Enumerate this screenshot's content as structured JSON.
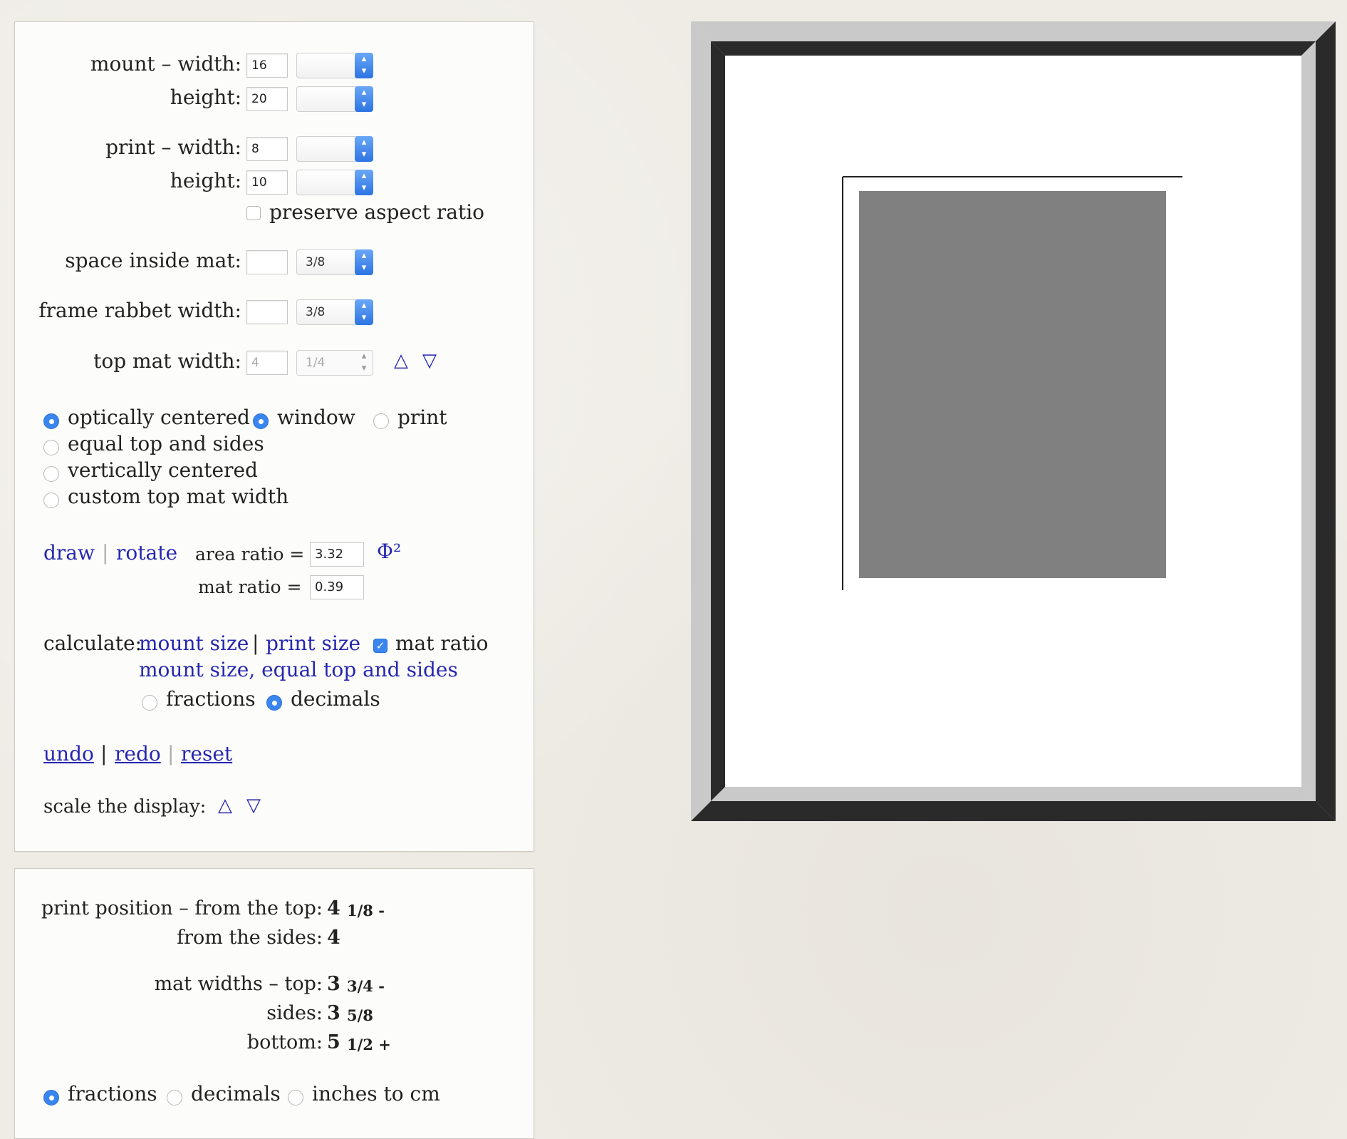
{
  "form": {
    "mount_label": "mount – width:",
    "mount_height_label": "height:",
    "mount_width_value": "16",
    "mount_width_frac": "",
    "mount_height_value": "20",
    "mount_height_frac": "",
    "print_label": "print – width:",
    "print_height_label": "height:",
    "print_width_value": "8",
    "print_width_frac": "",
    "print_height_value": "10",
    "print_height_frac": "",
    "preserve_label": "preserve aspect ratio",
    "space_label": "space inside mat:",
    "space_value": "",
    "space_frac": "3/8",
    "rabbet_label": "frame rabbet width:",
    "rabbet_value": "",
    "rabbet_frac": "3/8",
    "topmat_label": "top mat width:",
    "topmat_value": "4",
    "topmat_frac": "1/4",
    "up_arrow": "△",
    "down_arrow": "▽"
  },
  "positioning": {
    "optically_centered": "optically centered",
    "window": "window",
    "print": "print",
    "equal_top_sides": "equal top and sides",
    "vertically_centered": "vertically centered",
    "custom_top": "custom top mat width"
  },
  "actions": {
    "draw": "draw",
    "rotate": "rotate",
    "area_ratio_label": "area ratio =",
    "area_ratio_value": "3.32",
    "phi": "Φ²",
    "mat_ratio_label": "mat ratio =",
    "mat_ratio_value": "0.39"
  },
  "calculate": {
    "label": "calculate:",
    "mount_size": "mount size",
    "print_size": "print size",
    "mat_ratio": "mat ratio",
    "mount_equal": "mount size, equal top and sides",
    "fractions": "fractions",
    "decimals": "decimals"
  },
  "history": {
    "undo": "undo",
    "redo": "redo",
    "reset": "reset"
  },
  "scale": {
    "label": "scale the display:",
    "up": "△",
    "down": "▽"
  },
  "results": {
    "print_position_top_label": "print position – from the top:",
    "print_position_top_whole": "4",
    "print_position_top_frac": "1/8 -",
    "from_sides_label": "from the sides:",
    "from_sides_whole": "4",
    "mat_top_label": "mat widths – top:",
    "mat_top_whole": "3",
    "mat_top_frac": "3/4 -",
    "mat_sides_label": "sides:",
    "mat_sides_whole": "3",
    "mat_sides_frac": "5/8",
    "mat_bottom_label": "bottom:",
    "mat_bottom_whole": "5",
    "mat_bottom_frac": "1/2 +",
    "unit_fractions": "fractions",
    "unit_decimals": "decimals",
    "unit_cm": "inches to cm"
  },
  "colors": {
    "link": "#2626b0",
    "accent": "#3a86ee",
    "frame": "#2a2a2a",
    "mat": "#ffffff",
    "print": "#808080"
  }
}
